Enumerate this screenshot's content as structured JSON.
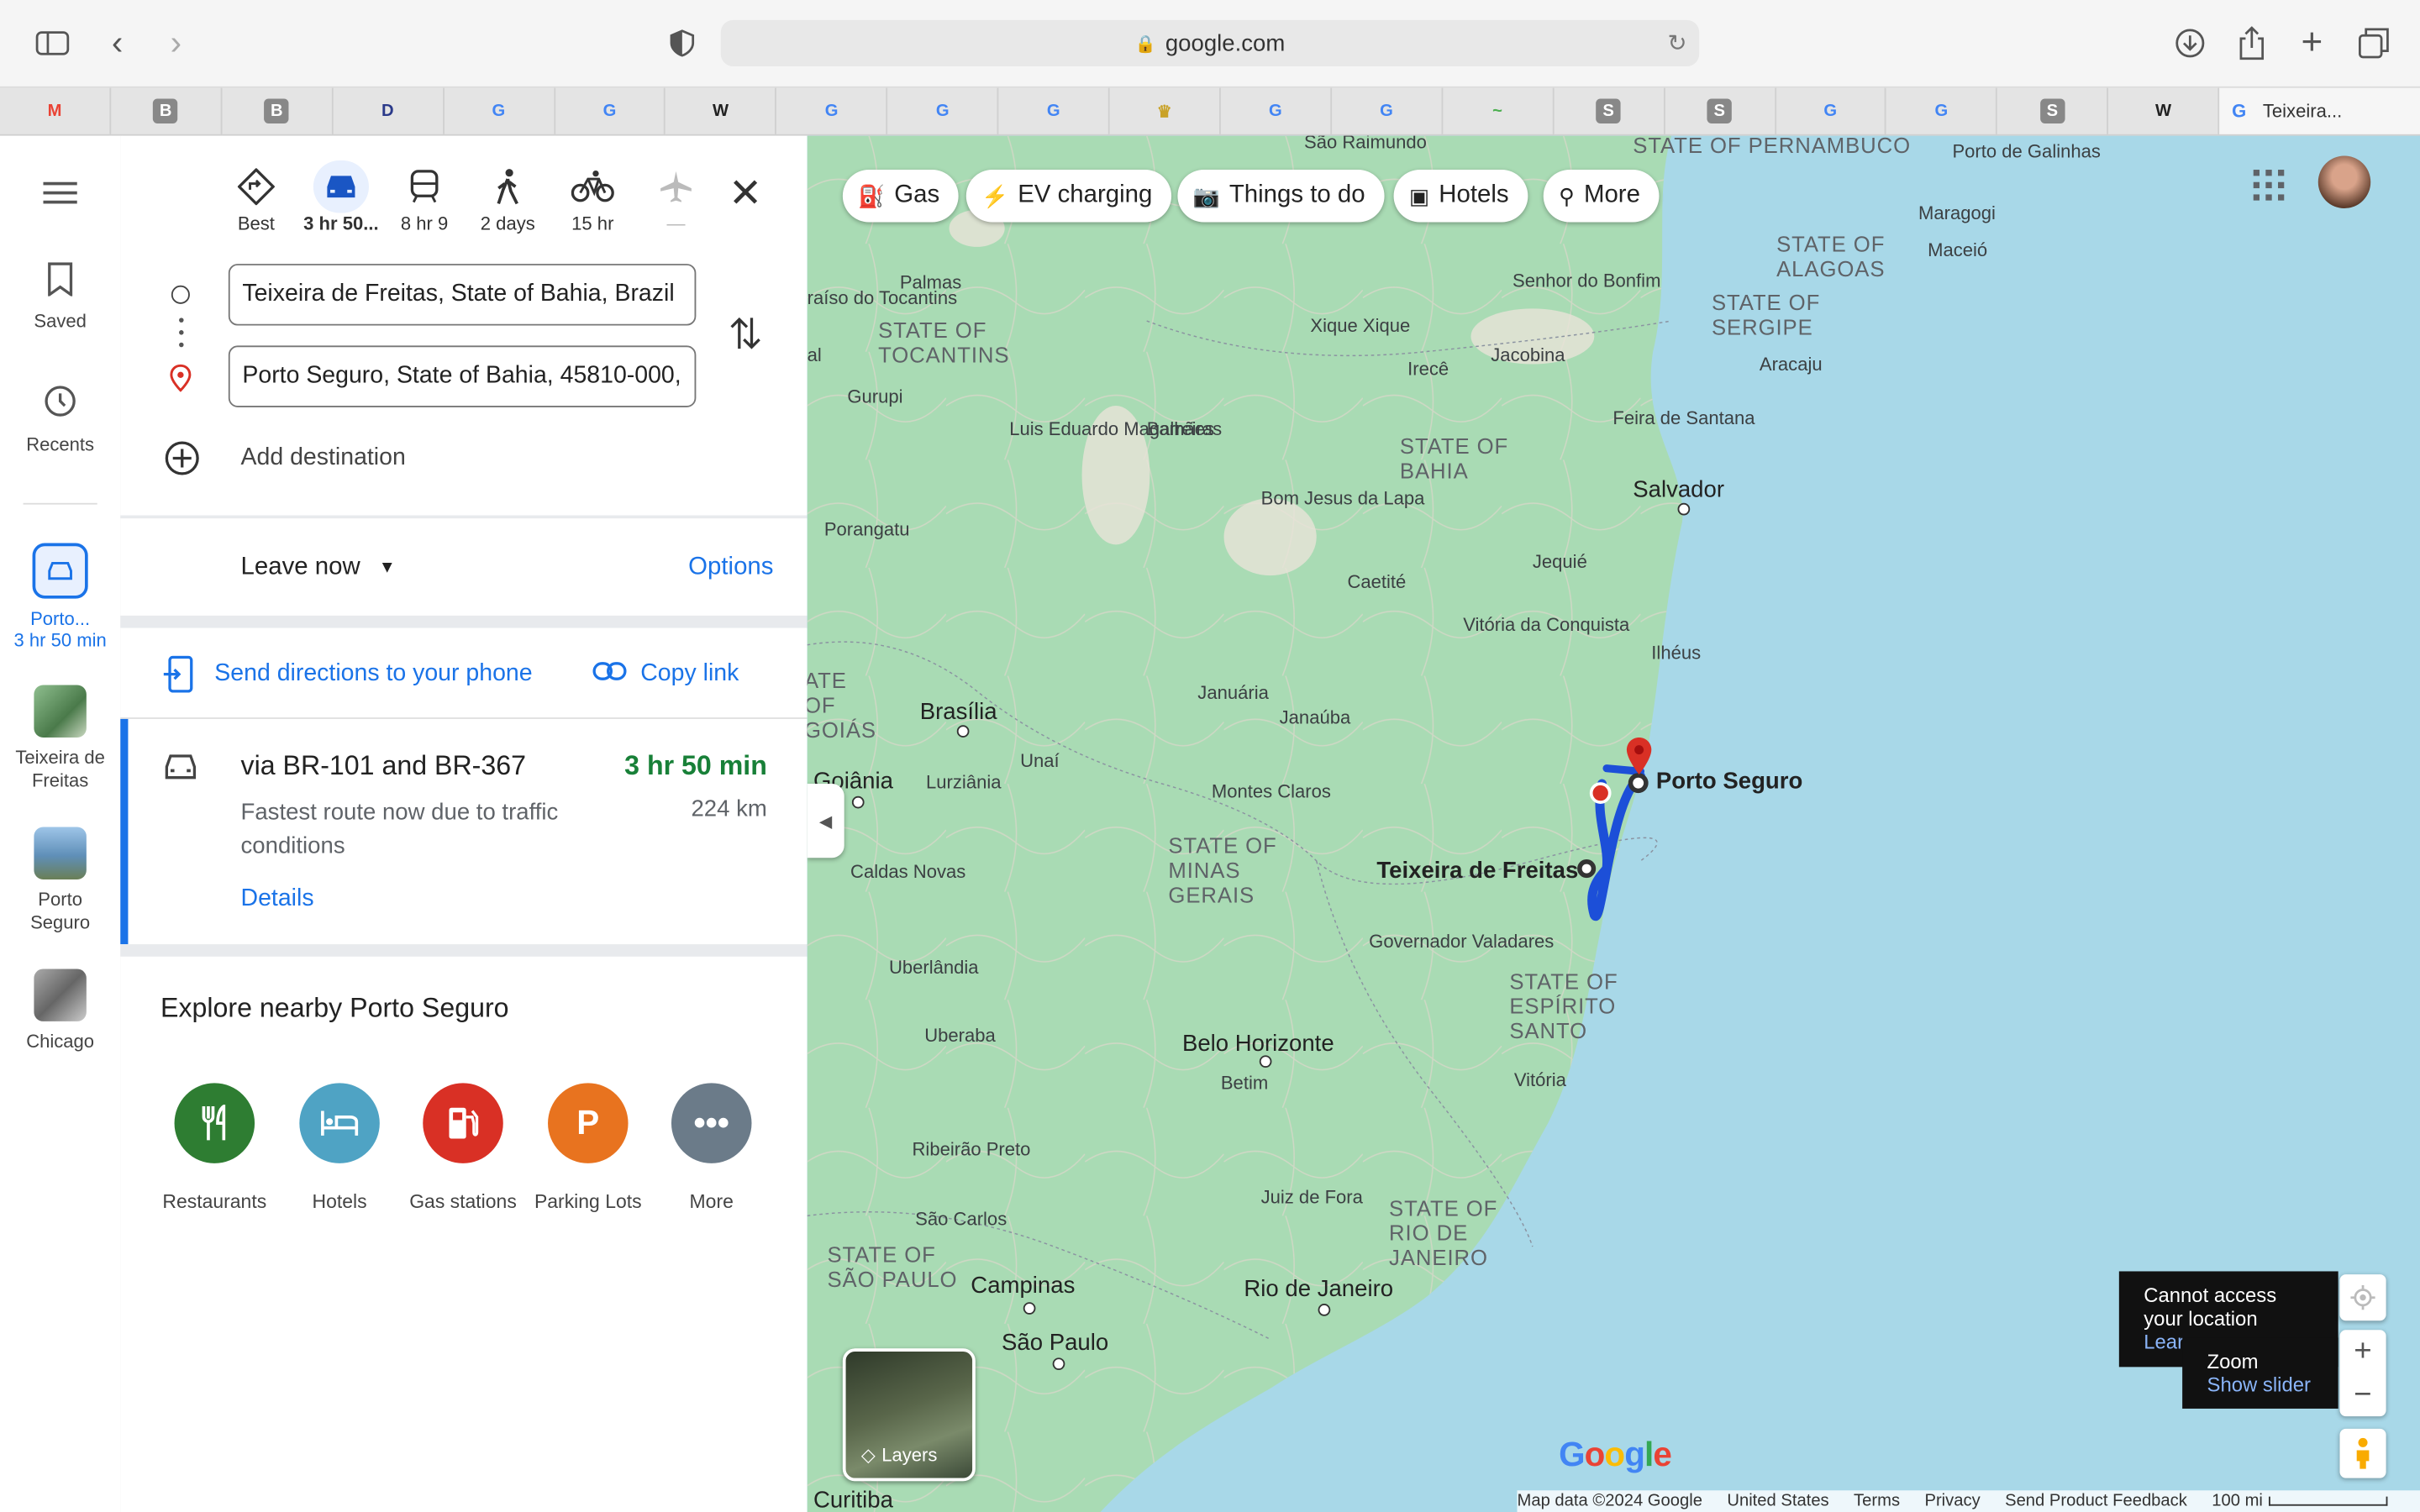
{
  "browser": {
    "url": "google.com",
    "active_tab": "Teixeira..."
  },
  "tabs": [
    "M",
    "B",
    "B",
    "D",
    "G",
    "G",
    "W",
    "G",
    "G",
    "G",
    "♛",
    "G",
    "G",
    "~",
    "S",
    "S",
    "G",
    "G",
    "S",
    "W"
  ],
  "rail": {
    "saved": "Saved",
    "recents": "Recents",
    "recent_trip": {
      "name": "Porto...",
      "time": "3 hr 50 min"
    },
    "places": [
      "Teixeira de Freitas",
      "Porto Seguro",
      "Chicago"
    ]
  },
  "modes": [
    {
      "label": "Best",
      "icon": "best-route-icon"
    },
    {
      "label": "3 hr 50...",
      "icon": "car-icon"
    },
    {
      "label": "8 hr 9",
      "icon": "transit-icon"
    },
    {
      "label": "2 days",
      "icon": "walk-icon"
    },
    {
      "label": "15 hr",
      "icon": "bike-icon"
    },
    {
      "label": "—",
      "icon": "flight-icon"
    }
  ],
  "origin": "Teixeira de Freitas, State of Bahia, Brazil",
  "destination": "Porto Seguro, State of Bahia, 45810-000,",
  "add_destination": "Add destination",
  "leave_now": "Leave now",
  "options": "Options",
  "send_to_phone": "Send directions to your phone",
  "copy_link": "Copy link",
  "route": {
    "via": "via BR-101 and BR-367",
    "duration": "3 hr 50 min",
    "distance": "224 km",
    "note": "Fastest route now due to traffic conditions",
    "details": "Details"
  },
  "explore": {
    "title": "Explore nearby Porto Seguro",
    "categories": [
      {
        "label": "Restaurants",
        "color": "#2e7d32",
        "icon": "fork-knife-icon"
      },
      {
        "label": "Hotels",
        "color": "#4fa3c4",
        "icon": "bed-icon"
      },
      {
        "label": "Gas stations",
        "color": "#d93025",
        "icon": "gas-pump-icon"
      },
      {
        "label": "Parking Lots",
        "color": "#e8731f",
        "icon": "parking-icon"
      },
      {
        "label": "More",
        "color": "#6b7b89",
        "icon": "more-icon"
      }
    ]
  },
  "chips": [
    "Gas",
    "EV charging",
    "Things to do",
    "Hotels",
    "More"
  ],
  "map_labels": {
    "states": [
      "STATE OF PERNAMBUCO",
      "STATE OF ALAGOAS",
      "STATE OF SERGIPE",
      "STATE OF TOCANTINS",
      "STATE OF BAHIA",
      "STATE OF MINAS GERAIS",
      "STATE OF ESPÍRITO SANTO",
      "STATE OF RIO DE JANEIRO",
      "STATE OF SÃO PAULO",
      "ATE OF GOIÁS"
    ],
    "towns": [
      "São Raimundo",
      "Porto de Galinhas",
      "Maragogi",
      "Maceió",
      "Aracaju",
      "Palmas",
      "raíso do Tocantins",
      "Senhor do Bonfim",
      "Xique Xique",
      "Irecê",
      "Jacobina",
      "Feira de Santana",
      "Gurupi",
      "Luis Eduardo Magalhães",
      "Barreiras",
      "Bom Jesus da Lapa",
      "Porangatu",
      "Jequié",
      "Caetité",
      "Vitória da Conquista",
      "Ilhéus",
      "Januária",
      "Janaúba",
      "Unaí",
      "Lurziânia",
      "Montes Claros",
      "Caldas Novas",
      "Uberlândia",
      "Governador Valadares",
      "Betim",
      "Vitória",
      "Uberaba",
      "Ribeirão Preto",
      "Juiz de Fora",
      "São Carlos",
      "Curitiba",
      "al"
    ],
    "cities": [
      "Salvador",
      "Brasília",
      "Goiânia",
      "Porto Seguro",
      "Teixeira de Freitas",
      "Belo Horizonte",
      "Rio de Janeiro",
      "Campinas",
      "São Paulo"
    ]
  },
  "location_tip": {
    "line1": "Cannot access",
    "line2": "your location",
    "link": "Lear"
  },
  "zoom_tip": {
    "title": "Zoom",
    "link": "Show slider"
  },
  "layers": "Layers",
  "google_logo": "Google",
  "footer": [
    "Map data ©2024 Google",
    "United States",
    "Terms",
    "Privacy",
    "Send Product Feedback",
    "100 mi"
  ]
}
